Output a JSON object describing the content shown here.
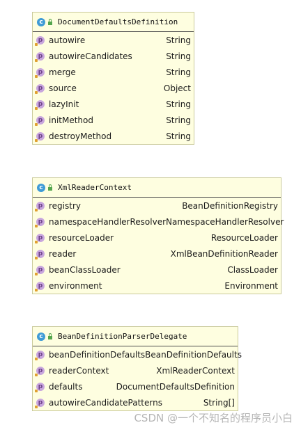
{
  "classes": [
    {
      "name": "DocumentDefaultsDefinition",
      "kind_badge": "c",
      "fields": [
        {
          "badge": "p",
          "name": "autowire",
          "type": "String"
        },
        {
          "badge": "p",
          "name": "autowireCandidates",
          "type": "String"
        },
        {
          "badge": "p",
          "name": "merge",
          "type": "String"
        },
        {
          "badge": "p",
          "name": "source",
          "type": "Object"
        },
        {
          "badge": "p",
          "name": "lazyInit",
          "type": "String"
        },
        {
          "badge": "p",
          "name": "initMethod",
          "type": "String"
        },
        {
          "badge": "p",
          "name": "destroyMethod",
          "type": "String"
        }
      ]
    },
    {
      "name": "XmlReaderContext",
      "kind_badge": "c",
      "fields": [
        {
          "badge": "p",
          "name": "registry",
          "type": "BeanDefinitionRegistry"
        },
        {
          "badge": "p",
          "name": "namespaceHandlerResolver",
          "type": "NamespaceHandlerResolver"
        },
        {
          "badge": "p",
          "name": "resourceLoader",
          "type": "ResourceLoader"
        },
        {
          "badge": "p",
          "name": "reader",
          "type": "XmlBeanDefinitionReader"
        },
        {
          "badge": "p",
          "name": "beanClassLoader",
          "type": "ClassLoader"
        },
        {
          "badge": "p",
          "name": "environment",
          "type": "Environment"
        }
      ]
    },
    {
      "name": "BeanDefinitionParserDelegate",
      "kind_badge": "c",
      "fields": [
        {
          "badge": "p",
          "name": "beanDefinitionDefaults",
          "type": "BeanDefinitionDefaults"
        },
        {
          "badge": "p",
          "name": "readerContext",
          "type": "XmlReaderContext"
        },
        {
          "badge": "p",
          "name": "defaults",
          "type": "DocumentDefaultsDefinition"
        },
        {
          "badge": "p",
          "name": "autowireCandidatePatterns",
          "type": "String[]"
        }
      ]
    }
  ],
  "watermark": "CSDN @一个不知名的程序员小白",
  "colors": {
    "box_fill": "#fefee0",
    "class_icon": "#3f9bd6",
    "field_icon": "#c8a6dd",
    "lock_icon": "#54a64d"
  }
}
